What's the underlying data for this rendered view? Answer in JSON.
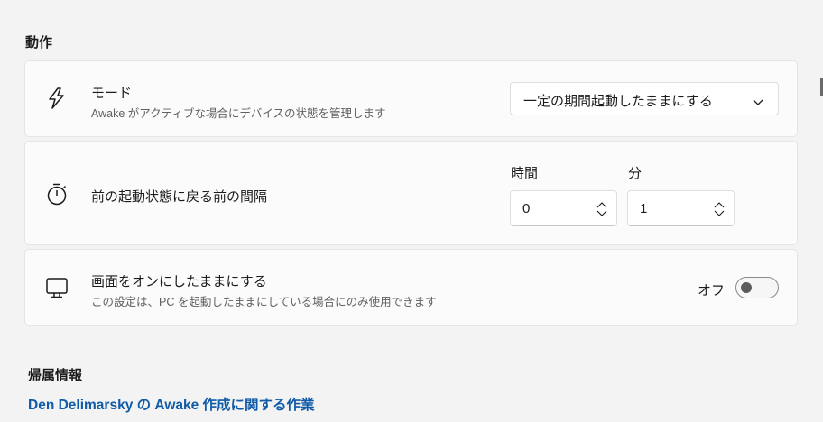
{
  "behavior_section": {
    "title": "動作"
  },
  "mode_setting": {
    "icon": "lightning-bolt-icon",
    "title": "モード",
    "description": "Awake がアクティブな場合にデバイスの状態を管理します",
    "dropdown_value": "一定の期間起動したままにする"
  },
  "interval_setting": {
    "icon": "stopwatch-icon",
    "title": "前の起動状態に戻る前の間隔",
    "hours_label": "時間",
    "hours_value": "0",
    "minutes_label": "分",
    "minutes_value": "1"
  },
  "screen_setting": {
    "icon": "monitor-icon",
    "title": "画面をオンにしたままにする",
    "description": "この設定は、PC を起動したままにしている場合にのみ使用できます",
    "toggle_label": "オフ",
    "toggle_on": false
  },
  "attribution_section": {
    "title": "帰属情報",
    "link_text": "Den Delimarsky の Awake 作成に関する作業"
  },
  "colors": {
    "background": "#f3f3f3",
    "card": "#fbfbfb",
    "link": "#0f5ba8"
  }
}
